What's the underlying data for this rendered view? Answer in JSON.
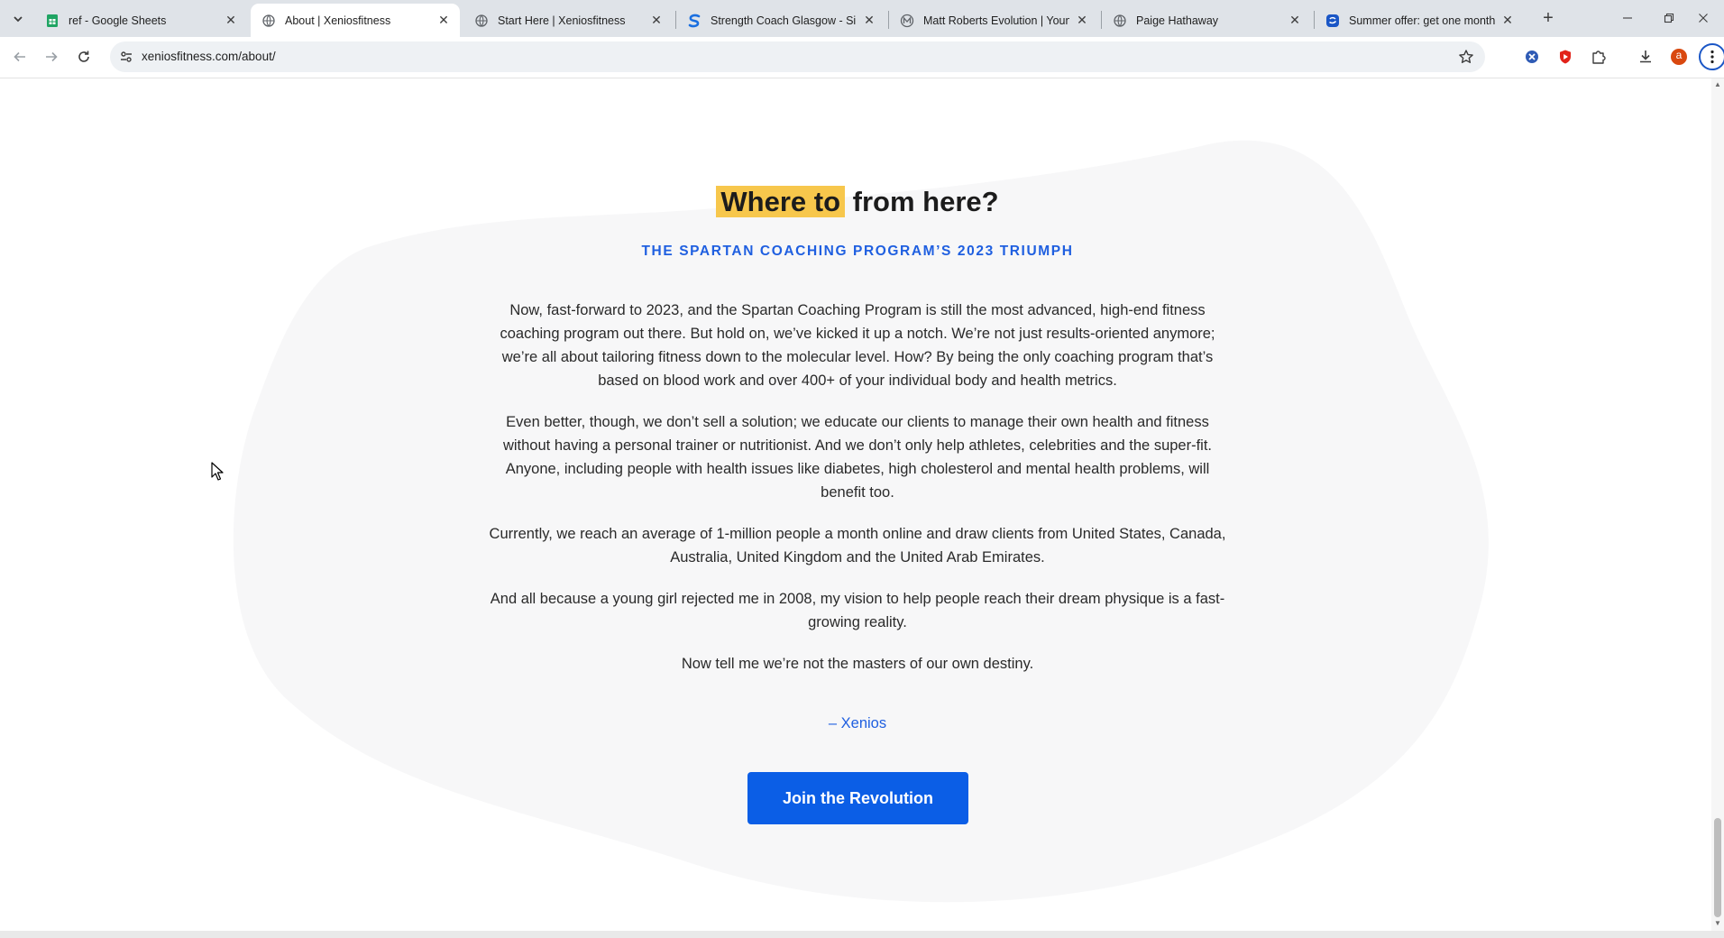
{
  "browser": {
    "tabs": [
      {
        "title": "ref - Google Sheets",
        "icon": "google-sheets-icon",
        "active": false
      },
      {
        "title": "About | Xeniosfitness",
        "icon": "globe-icon",
        "active": true
      },
      {
        "title": "Start Here | Xeniosfitness",
        "icon": "globe-icon",
        "active": false
      },
      {
        "title": "Strength Coach Glasgow - Simp",
        "icon": "s-logo-icon",
        "active": false
      },
      {
        "title": "Matt Roberts Evolution | Young",
        "icon": "m-logo-icon",
        "active": false
      },
      {
        "title": "Paige Hathaway",
        "icon": "globe-icon",
        "active": false
      },
      {
        "title": "Summer offer: get one month f",
        "icon": "blue-logo-icon",
        "active": false
      }
    ],
    "close_glyph": "✕",
    "new_tab_glyph": "+",
    "url": "xeniosfitness.com/about/",
    "profile_initial": "a",
    "accent_color": "#1f5fe0"
  },
  "page": {
    "heading_highlight": "Where to",
    "heading_rest": " from here?",
    "subheading": "THE SPARTAN COACHING PROGRAM’S 2023 TRIUMPH",
    "paragraphs": [
      "Now, fast-forward to 2023, and the Spartan Coaching Program is still the most advanced, high-end fitness coaching program out there. But hold on, we’ve kicked it up a notch. We’re not just results-oriented anymore; we’re all about tailoring fitness down to the molecular level. How? By being the only coaching program that’s based on blood work and over 400+ of your individual body and health metrics.",
      "Even better, though, we don’t sell a solution; we educate our clients to manage their own health and fitness without having a personal trainer or nutritionist. And we don’t only help athletes, celebrities and the super-fit. Anyone, including people with health issues like diabetes, high cholesterol and mental health problems, will benefit too.",
      "Currently, we reach an average of 1-million people a month online and draw clients from United States, Canada, Australia, United Kingdom and the United Arab Emirates.",
      "And all because a young girl rejected me in 2008, my vision to help people reach their dream physique is a fast-growing reality.",
      "Now tell me we’re not the masters of our own destiny."
    ],
    "signature": "– Xenios",
    "cta_label": "Join the Revolution",
    "highlight_color": "#f7c74c",
    "cta_color": "#0b5ee6"
  }
}
